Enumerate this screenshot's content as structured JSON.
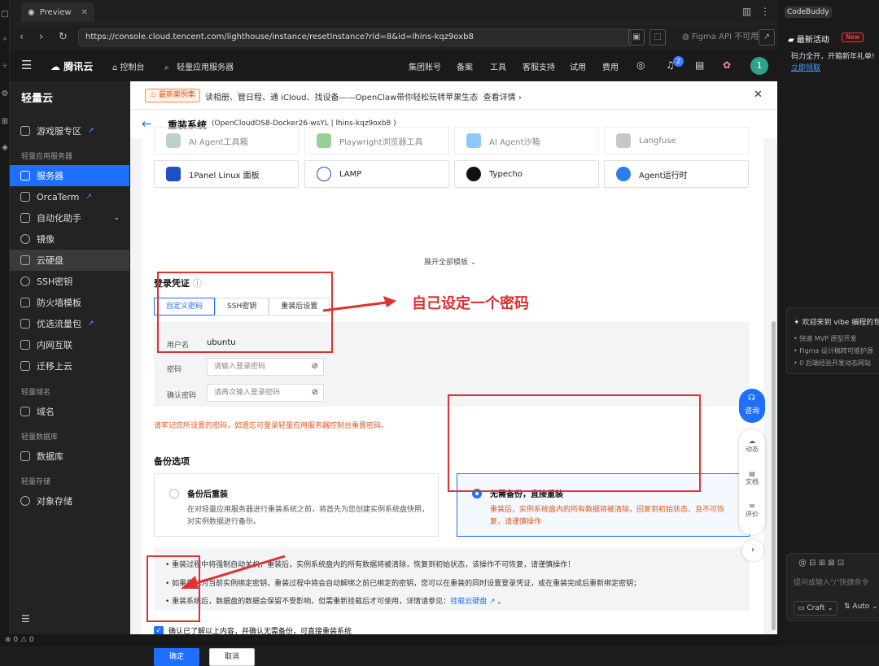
{
  "browser": {
    "tab_title": "Preview",
    "url": "https://console.cloud.tencent.com/lighthouse/instance/resetInstance?rid=8&id=lhins-kqz9oxb8",
    "figma_label": "Figma API 不可用"
  },
  "topbar": {
    "brand": "腾讯云",
    "console": "控制台",
    "search": "轻量应用服务器",
    "links": [
      "集团账号",
      "备案",
      "工具",
      "客服支持",
      "试用",
      "费用"
    ],
    "badge": "2",
    "avatar": "1"
  },
  "sidebar": {
    "title": "轻量云",
    "game": "游戏服专区",
    "sec_app": "轻量应用服务器",
    "items": [
      "服务器",
      "OrcaTerm",
      "自动化助手",
      "镜像",
      "云硬盘",
      "SSH密钥",
      "防火墙模板",
      "优选流量包",
      "内网互联",
      "迁移上云"
    ],
    "sec_domain": "轻量域名",
    "domain": "域名",
    "sec_db": "轻量数据库",
    "db": "数据库",
    "sec_storage": "轻量存储",
    "storage": "对象存储"
  },
  "banner": {
    "tag": "最新案例集",
    "text": "读相册、管日程、通 iCloud、找设备——OpenClaw带你轻松玩转苹果生态",
    "link": "查看详情"
  },
  "header": {
    "title": "重装系统",
    "sub": "(OpenCloudOS8-Docker26-wsYL | lhins-kqz9oxb8 )"
  },
  "templates": {
    "row1": [
      "AI Agent工具箱",
      "Playwright浏览器工具",
      "AI Agent沙箱",
      "Langfuse"
    ],
    "row2": [
      "1Panel Linux 面板",
      "LAMP",
      "Typecho",
      "Agent运行时"
    ],
    "expand": "展开全部模板"
  },
  "login": {
    "title": "登录凭证",
    "tabs": [
      "自定义密码",
      "SSH密钥",
      "重装后设置"
    ],
    "user_label": "用户名",
    "user_value": "ubuntu",
    "pwd_label": "密码",
    "pwd_placeholder": "请输入登录密码",
    "confirm_label": "确认密码",
    "confirm_placeholder": "请再次输入登录密码",
    "hint": "请牢记您所设置的密码，如遗忘可登录轻量应用服务器控制台重置密码。"
  },
  "annotation": "自己设定一个密码",
  "backup": {
    "title": "备份选项",
    "opt1_title": "备份后重装",
    "opt1_desc": "在对轻量应用服务器进行重装系统之前，将首先为您创建实例系统盘快照，对实例数据进行备份。",
    "opt2_title": "无需备份，直接重装",
    "opt2_desc": "重装后，实例系统盘内的所有数据将被清除，回复到初始状态，且不可恢复，请谨慎操作"
  },
  "notes": {
    "n1": "重装过程中将强制自动关机；重装后，实例系统盘内的所有数据将被清除，恢复到初始状态，该操作不可恢复，请谨慎操作！",
    "n2": "如果您已为当前实例绑定密钥，重装过程中将会自动解绑之前已绑定的密钥，您可以在重装的同时设置登录凭证，或在重装完成后重新绑定密钥；",
    "n3": "重装系统后，数据盘的数据会保留不受影响，但需重新挂载后才可使用，详情请参见：",
    "n3_link": "挂载云硬盘"
  },
  "confirm_text": "确认已了解以上内容，并确认无需备份，可直接重装系统",
  "buttons": {
    "ok": "确定",
    "cancel": "取消"
  },
  "float": {
    "consult": "咨询",
    "dyn": "动态",
    "doc": "文档",
    "rate": "评价"
  },
  "right": {
    "app": "CodeBuddy",
    "activity": "最新活动",
    "new": "New",
    "act_text": "码力全开，开箱新年礼单!",
    "act_link": "立即领取",
    "welcome": "欢迎来到 vibe 编程的世",
    "w1": "快速 MVP 原型开发",
    "w2": "Figma 设计稿转可维护源",
    "w3": "0 后端经验开发动态网站",
    "chat_placeholder": "提问或输入\"/\"快捷命令",
    "mode": "Craft",
    "model": "Auto"
  },
  "status": "⊗ 0 ⚠ 0"
}
